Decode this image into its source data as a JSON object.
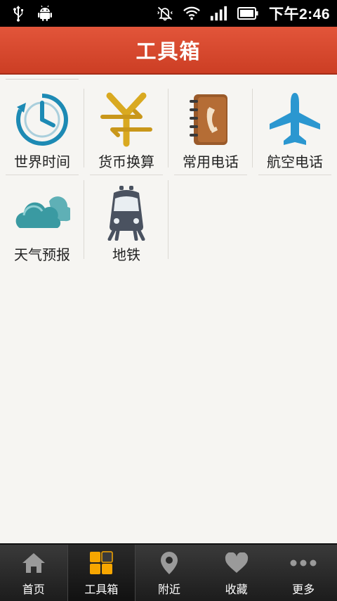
{
  "status_bar": {
    "time": "下午2:46",
    "icons": [
      "usb-icon",
      "android-debug-icon",
      "mute-vibrate-icon",
      "wifi-icon",
      "signal-icon",
      "battery-icon"
    ]
  },
  "header": {
    "title": "工具箱"
  },
  "tools": [
    {
      "label": "世界时间",
      "icon": "clock-icon"
    },
    {
      "label": "货币换算",
      "icon": "yen-exchange-icon"
    },
    {
      "label": "常用电话",
      "icon": "phonebook-icon"
    },
    {
      "label": "航空电话",
      "icon": "airplane-icon"
    },
    {
      "label": "天气预报",
      "icon": "cloud-icon"
    },
    {
      "label": "地铁",
      "icon": "subway-icon"
    }
  ],
  "bottom_nav": [
    {
      "label": "首页",
      "icon": "home-icon",
      "active": false
    },
    {
      "label": "工具箱",
      "icon": "toolbox-grid-icon",
      "active": true
    },
    {
      "label": "附近",
      "icon": "location-pin-icon",
      "active": false
    },
    {
      "label": "收藏",
      "icon": "heart-icon",
      "active": false
    },
    {
      "label": "更多",
      "icon": "more-dots-icon",
      "active": false
    }
  ],
  "colors": {
    "header": "#d94a2f",
    "background": "#f6f5f2",
    "accent_active": "#f7a600"
  }
}
